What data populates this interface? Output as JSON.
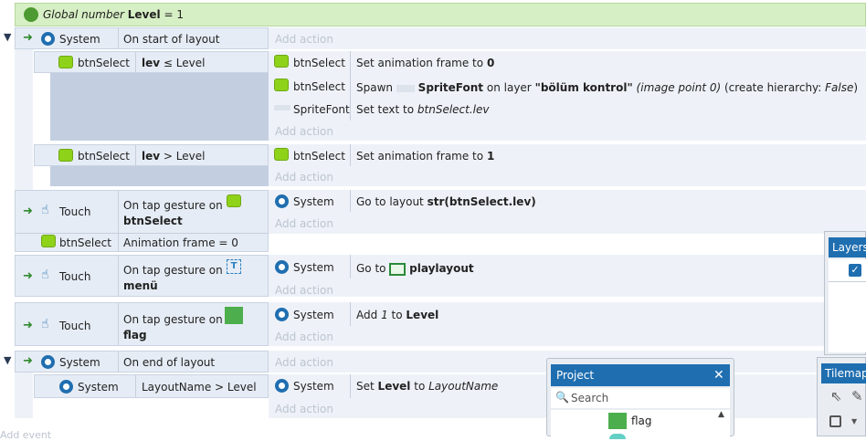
{
  "global_var": {
    "label": "Global number",
    "name": "Level",
    "eq": "= 1"
  },
  "add_action": "Add action",
  "add_event": "Add event",
  "ev1": {
    "object": "System",
    "condition": "On start of layout"
  },
  "sub1": {
    "object": "btnSelect",
    "cond_a": "lev",
    "cond_op": "≤ Level",
    "actions": [
      {
        "object": "btnSelect",
        "text": "Set animation frame to",
        "value": "0"
      },
      {
        "object": "btnSelect",
        "text": "Spawn",
        "spawn_obj": "SpriteFont",
        "on": "on layer",
        "layer": "\"bölüm kontrol\"",
        "point": "(image point 0)",
        "hier": "(create hierarchy:",
        "hier_val": "False",
        "close": ")"
      },
      {
        "object": "SpriteFont",
        "text": "Set text to",
        "value": "btnSelect.lev"
      }
    ]
  },
  "sub2": {
    "object": "btnSelect",
    "cond_a": "lev",
    "cond_op": "> Level",
    "action": {
      "object": "btnSelect",
      "text": "Set animation frame to",
      "value": "1"
    }
  },
  "ev2": {
    "object": "Touch",
    "cond1": "On tap gesture on",
    "cond1_obj": "btnSelect",
    "object2": "btnSelect",
    "cond2": "Animation frame = 0",
    "action": {
      "object": "System",
      "text": "Go to layout",
      "value": "str(btnSelect.lev)"
    }
  },
  "ev3": {
    "object": "Touch",
    "cond": "On tap gesture on",
    "cond_obj": "menü",
    "action": {
      "object": "System",
      "text": "Go to",
      "value": "playlayout"
    }
  },
  "ev4": {
    "object": "Touch",
    "cond": "On tap gesture on",
    "cond_obj": "flag",
    "action": {
      "object": "System",
      "text": "Add",
      "num": "1",
      "to": "to",
      "value": "Level"
    }
  },
  "ev5": {
    "object": "System",
    "condition": "On end of layout"
  },
  "sub3": {
    "object": "System",
    "condition": "LayoutName > Level",
    "action": {
      "object": "System",
      "text": "Set",
      "var": "Level",
      "to": "to",
      "value": "LayoutName"
    }
  },
  "project_panel": {
    "title": "Project",
    "close": "✕",
    "search_placeholder": "Search",
    "item": "flag"
  },
  "layers_panel": {
    "title": "Layers"
  },
  "tilemap_panel": {
    "title": "Tilemap"
  },
  "colors": {
    "accent": "#1f6eb0",
    "sprite": "#8fd21a",
    "flag": "#4cae4c"
  }
}
